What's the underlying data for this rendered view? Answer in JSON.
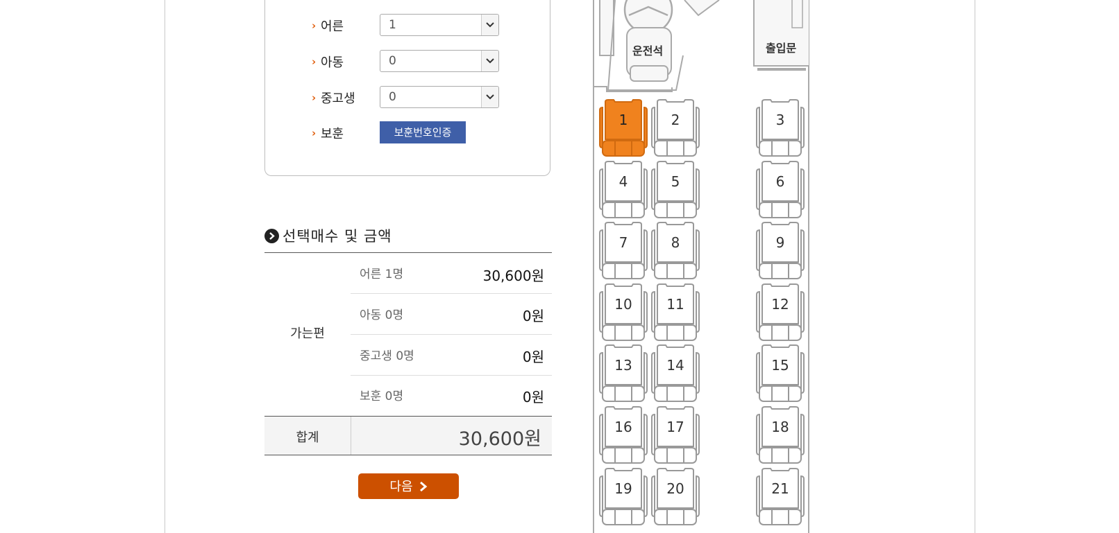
{
  "passengers": {
    "rows": [
      {
        "label": "어른",
        "value": "1"
      },
      {
        "label": "아동",
        "value": "0"
      },
      {
        "label": "중고생",
        "value": "0"
      },
      {
        "label": "보훈",
        "button": "보훈번호인증"
      }
    ]
  },
  "summary": {
    "title": "선택매수 및 금액",
    "category": "가는편",
    "items": [
      {
        "label": "어른 1명",
        "price": "30,600원"
      },
      {
        "label": "아동 0명",
        "price": "0원"
      },
      {
        "label": "중고생 0명",
        "price": "0원"
      },
      {
        "label": "보훈 0명",
        "price": "0원"
      }
    ],
    "total_label": "합계",
    "total_value": "30,600원",
    "next_label": "다음"
  },
  "bus": {
    "driver_label": "운전석",
    "door_label": "출입문",
    "selected_seat": "1",
    "selected_color": "#f0821e",
    "seats": [
      "1",
      "2",
      "3",
      "4",
      "5",
      "6",
      "7",
      "8",
      "9",
      "10",
      "11",
      "12",
      "13",
      "14",
      "15",
      "16",
      "17",
      "18",
      "19",
      "20",
      "21"
    ]
  }
}
